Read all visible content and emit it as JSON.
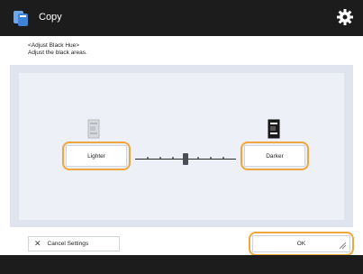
{
  "app": {
    "title": "Copy"
  },
  "header": {
    "line1": "<Adjust Black Hue>",
    "line2": "Adjust the black areas."
  },
  "adjust": {
    "lighter_label": "Lighter",
    "darker_label": "Darker",
    "level_fraction": 0.5,
    "steps": 8
  },
  "footer": {
    "cancel_label": "Cancel Settings",
    "ok_label": "OK"
  },
  "colors": {
    "highlight": "#f0a63c",
    "titlebar": "#1c1c1c",
    "panel": "#dfe4ef"
  },
  "icons": {
    "app": "copy-app-icon",
    "settings": "gear-icon",
    "cancel": "close-x-icon"
  }
}
